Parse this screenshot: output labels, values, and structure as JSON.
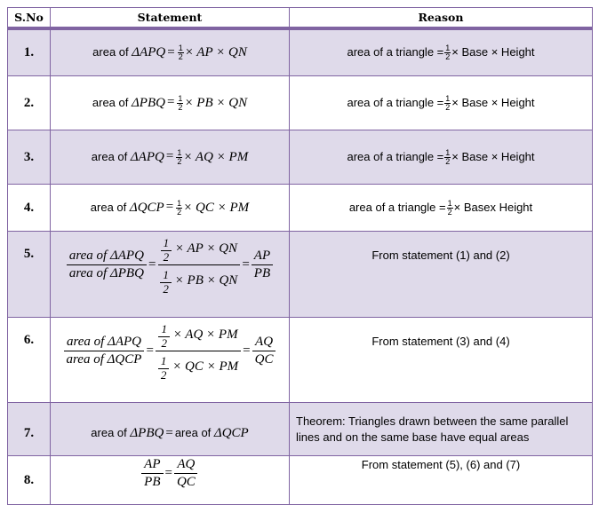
{
  "headers": {
    "sno": "S.No",
    "statement": "Statement",
    "reason": "Reason"
  },
  "rows": [
    {
      "no": "1.",
      "stmt": {
        "prefix": "area of ",
        "tri": "ΔAPQ",
        "eq": "=",
        "half_n": "1",
        "half_d": "2",
        "rest": "× AP × QN"
      },
      "reason": {
        "prefix": "area of a triangle =",
        "half_n": "1",
        "half_d": "2",
        "rest": "× Base × Height"
      }
    },
    {
      "no": "2.",
      "stmt": {
        "prefix": "area of ",
        "tri": "ΔPBQ",
        "eq": "=",
        "half_n": "1",
        "half_d": "2",
        "rest": "× PB × QN"
      },
      "reason": {
        "prefix": "area of a triangle =",
        "half_n": "1",
        "half_d": "2",
        "rest": "× Base × Height"
      }
    },
    {
      "no": "3.",
      "stmt": {
        "prefix": "area of ",
        "tri": "ΔAPQ",
        "eq": "=",
        "half_n": "1",
        "half_d": "2",
        "rest": "× AQ × PM"
      },
      "reason": {
        "prefix": "area of a triangle =",
        "half_n": "1",
        "half_d": "2",
        "rest": "× Base × Height"
      }
    },
    {
      "no": "4.",
      "stmt": {
        "prefix": "area of ",
        "tri": "ΔQCP",
        "eq": "=",
        "half_n": "1",
        "half_d": "2",
        "rest": "× QC × PM"
      },
      "reason": {
        "prefix": "area of a triangle =",
        "half_n": "1",
        "half_d": "2",
        "rest": "× Basex Height"
      }
    },
    {
      "no": "5.",
      "stmt": {
        "lhs_n": "area of ΔAPQ",
        "lhs_d": "area of ΔPBQ",
        "eq": "=",
        "mid_n_half": "1/2",
        "mid_n": "× AP × QN",
        "mid_d": "× PB × QN",
        "rhs_n": "AP",
        "rhs_d": "PB"
      },
      "reason": "From statement (1) and (2)"
    },
    {
      "no": "6.",
      "stmt": {
        "lhs_n": "area of ΔAPQ",
        "lhs_d": "area of ΔQCP",
        "eq": "=",
        "mid_n": "× AQ × PM",
        "mid_d": "× QC × PM",
        "rhs_n": "AQ",
        "rhs_d": "QC"
      },
      "reason": "From statement (3) and (4)"
    },
    {
      "no": "7.",
      "stmt": {
        "prefix": "area of ",
        "tri": "ΔPBQ",
        "eq": "=",
        "mid": "area of ",
        "tri2": "ΔQCP"
      },
      "reason": "Theorem: Triangles drawn between the same parallel lines and on the same base have equal areas"
    },
    {
      "no": "8.",
      "stmt": {
        "lhs_n": "AP",
        "lhs_d": "PB",
        "eq": "=",
        "rhs_n": "AQ",
        "rhs_d": "QC"
      },
      "reason": "From statement (5), (6) and (7)"
    }
  ],
  "colors": {
    "border": "#8064a2",
    "shade": "#dfdaea"
  }
}
